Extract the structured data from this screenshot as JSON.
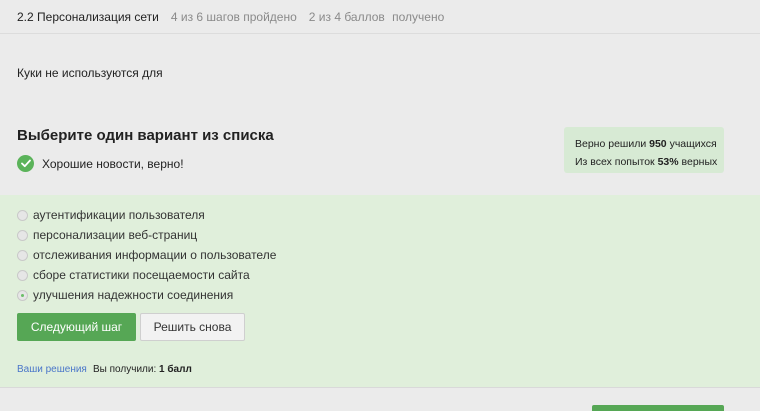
{
  "header": {
    "lesson_title": "2.2 Персонализация сети",
    "steps_progress": "4 из 6 шагов пройдено",
    "score_points": "2 из 4 баллов",
    "score_suffix": "получено"
  },
  "question": {
    "text": "Куки не используются для"
  },
  "task": {
    "title": "Выберите один вариант из списка",
    "feedback": "Хорошие новости, верно!"
  },
  "stats": {
    "solved_prefix": "Верно решили",
    "solved_count": "950",
    "solved_suffix": "учащихся",
    "attempts_prefix": "Из всех попыток",
    "attempts_percent": "53%",
    "attempts_suffix": "верных"
  },
  "options": [
    {
      "label": "аутентификации пользователя",
      "selected": false
    },
    {
      "label": "персонализации веб-страниц",
      "selected": false
    },
    {
      "label": "отслеживания информации о пользователе",
      "selected": false
    },
    {
      "label": "сборе статистики посещаемости сайта",
      "selected": false
    },
    {
      "label": "улучшения надежности соединения",
      "selected": true
    }
  ],
  "buttons": {
    "next_label": "Следующий шаг",
    "retry_label": "Решить снова"
  },
  "footer": {
    "solutions_link": "Ваши решения",
    "received_prefix": "Вы получили:",
    "received_value": "1 балл"
  },
  "colors": {
    "accent_green": "#56a755",
    "panel_green": "#e0efdb",
    "stats_green": "#d7ead4",
    "link_blue": "#4a76c9"
  }
}
